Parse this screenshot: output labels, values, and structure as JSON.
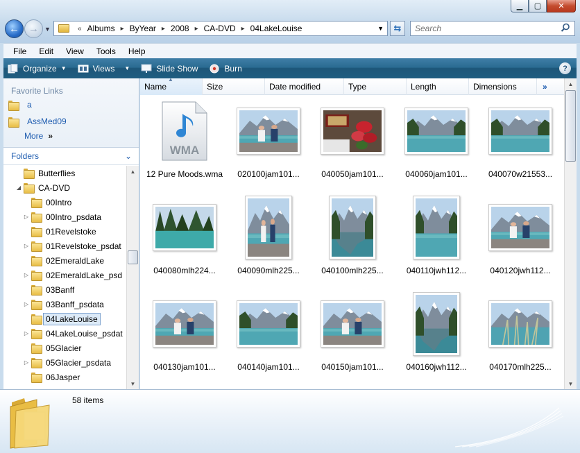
{
  "window": {
    "controls": [
      "minimize",
      "maximize",
      "close"
    ]
  },
  "navigation": {
    "breadcrumb_overflow": "«",
    "breadcrumb": [
      "Albums",
      "ByYear",
      "2008",
      "CA-DVD",
      "04LakeLouise"
    ],
    "search_placeholder": "Search"
  },
  "menu": [
    "File",
    "Edit",
    "View",
    "Tools",
    "Help"
  ],
  "commands": {
    "organize": "Organize",
    "views": "Views",
    "slideshow": "Slide Show",
    "burn": "Burn",
    "help": "?"
  },
  "favorites": {
    "title": "Favorite Links",
    "items": [
      "a",
      "AssMed09"
    ],
    "more": "More",
    "more_arrows": "»"
  },
  "folders": {
    "title": "Folders",
    "tree": [
      {
        "label": "Butterflies",
        "indent": 1,
        "expander": "",
        "selected": false
      },
      {
        "label": "CA-DVD",
        "indent": 1,
        "expander": "open",
        "selected": false
      },
      {
        "label": "00Intro",
        "indent": 2,
        "expander": "",
        "selected": false
      },
      {
        "label": "00Intro_psdata",
        "indent": 2,
        "expander": "closed",
        "selected": false
      },
      {
        "label": "01Revelstoke",
        "indent": 2,
        "expander": "",
        "selected": false
      },
      {
        "label": "01Revelstoke_psdat",
        "indent": 2,
        "expander": "closed",
        "selected": false
      },
      {
        "label": "02EmeraldLake",
        "indent": 2,
        "expander": "",
        "selected": false
      },
      {
        "label": "02EmeraldLake_psd",
        "indent": 2,
        "expander": "closed",
        "selected": false
      },
      {
        "label": "03Banff",
        "indent": 2,
        "expander": "",
        "selected": false
      },
      {
        "label": "03Banff_psdata",
        "indent": 2,
        "expander": "closed",
        "selected": false
      },
      {
        "label": "04LakeLouise",
        "indent": 2,
        "expander": "",
        "selected": true
      },
      {
        "label": "04LakeLouise_psdat",
        "indent": 2,
        "expander": "closed",
        "selected": false
      },
      {
        "label": "05Glacier",
        "indent": 2,
        "expander": "",
        "selected": false
      },
      {
        "label": "05Glacier_psdata",
        "indent": 2,
        "expander": "closed",
        "selected": false
      },
      {
        "label": "06Jasper",
        "indent": 2,
        "expander": "",
        "selected": false
      }
    ]
  },
  "columns": [
    "Name",
    "Size",
    "Date modified",
    "Type",
    "Length",
    "Dimensions"
  ],
  "columns_more": "»",
  "files": [
    {
      "name": "12 Pure Moods.wma",
      "kind": "wma",
      "wma_label": "WMA"
    },
    {
      "name": "020100jam101...",
      "kind": "photo",
      "orient": "landscape",
      "scene": "people"
    },
    {
      "name": "040050jam101...",
      "kind": "photo",
      "orient": "landscape",
      "scene": "flowers"
    },
    {
      "name": "040060jam101...",
      "kind": "photo",
      "orient": "landscape",
      "scene": "lake"
    },
    {
      "name": "040070w21553...",
      "kind": "photo",
      "orient": "landscape",
      "scene": "lake"
    },
    {
      "name": "040080mlh224...",
      "kind": "photo",
      "orient": "landscape",
      "scene": "forest"
    },
    {
      "name": "040090mlh225...",
      "kind": "photo",
      "orient": "portrait",
      "scene": "people"
    },
    {
      "name": "040100mlh225...",
      "kind": "photo",
      "orient": "portrait",
      "scene": "mountain"
    },
    {
      "name": "040110jwh112...",
      "kind": "photo",
      "orient": "portrait",
      "scene": "lake"
    },
    {
      "name": "040120jwh112...",
      "kind": "photo",
      "orient": "landscape",
      "scene": "people"
    },
    {
      "name": "040130jam101...",
      "kind": "photo",
      "orient": "landscape",
      "scene": "people"
    },
    {
      "name": "040140jam101...",
      "kind": "photo",
      "orient": "landscape",
      "scene": "lake"
    },
    {
      "name": "040150jam101...",
      "kind": "photo",
      "orient": "landscape",
      "scene": "people"
    },
    {
      "name": "040160jwh112...",
      "kind": "photo",
      "orient": "portrait",
      "scene": "mountain"
    },
    {
      "name": "040170mlh225...",
      "kind": "photo",
      "orient": "landscape",
      "scene": "grass"
    }
  ],
  "status": {
    "item_count": "58 items"
  }
}
